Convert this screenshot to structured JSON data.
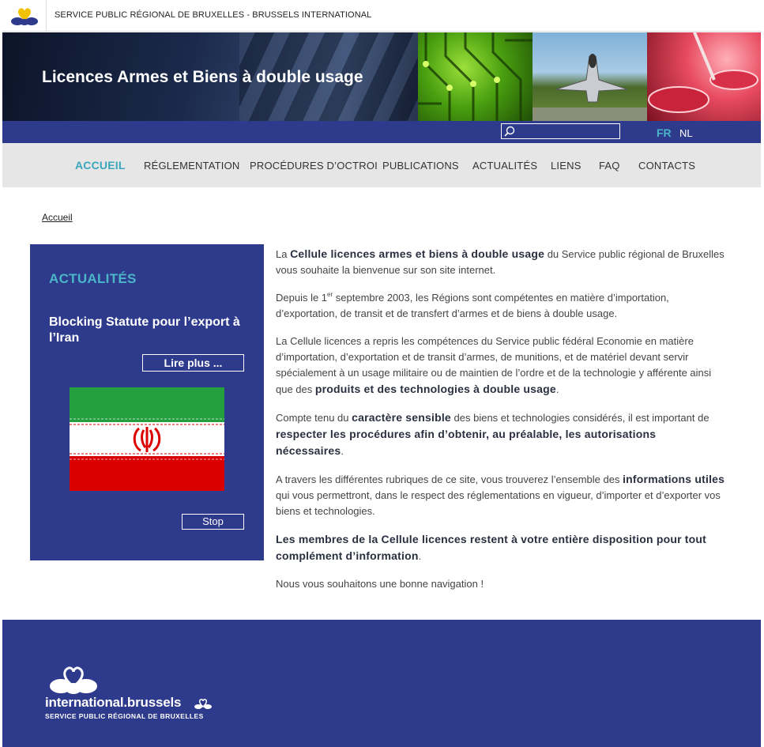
{
  "header": {
    "org_name": "SERVICE PUBLIC RÉGIONAL DE BRUXELLES - BRUSSELS INTERNATIONAL",
    "site_title": "Licences Armes et Biens à double usage"
  },
  "languages": [
    {
      "label": "FR",
      "active": true
    },
    {
      "label": "NL",
      "active": false
    }
  ],
  "search": {
    "placeholder": ""
  },
  "nav": {
    "items": [
      {
        "label": "ACCUEIL",
        "active": true
      },
      {
        "label": "RÉGLEMENTATION"
      },
      {
        "label": "PROCÉDURES D’OCTROI"
      },
      {
        "label": "PUBLICATIONS"
      },
      {
        "label": "ACTUALITÉS"
      },
      {
        "label": "LIENS"
      },
      {
        "label": "FAQ"
      },
      {
        "label": "CONTACTS"
      }
    ]
  },
  "breadcrumb": {
    "home": "Accueil"
  },
  "news": {
    "heading": "ACTUALITÉS",
    "headline": "Blocking Statute pour l’export à l’Iran",
    "read_more": "Lire plus ...",
    "stop": "Stop"
  },
  "main": {
    "p1_a": "La ",
    "p1_b": "Cellule licences armes et biens à double usage",
    "p1_c": " du Service public régional de Bruxelles vous souhaite la bienvenue sur son site internet.",
    "p2_a": "Depuis le 1",
    "p2_sup": "er",
    "p2_b": " septembre 2003, les Régions sont compétentes en matière d’importation, d’exportation, de transit et de transfert d’armes et de biens à double usage.",
    "p3_a": "La Cellule licences a repris les compétences du Service public fédéral Economie en matière d’importation, d’exportation et de transit d’armes, de munitions, et de matériel devant servir spécialement à un usage militaire ou de maintien de l’ordre et de la technologie y afférente ainsi que des ",
    "p3_b": "produits et des technologies à double usage",
    "p3_c": ".",
    "p4_a": "Compte tenu du ",
    "p4_b": "caractère sensible",
    "p4_c": " des biens et technologies considérés, il est important de ",
    "p4_d": "respecter les procédures afin d’obtenir, au préalable, les autorisations nécessaires",
    "p4_e": ".",
    "p5_a": "A travers les différentes rubriques de ce site, vous trouverez l’ensemble des ",
    "p5_b": "informations utiles",
    "p5_c": " qui vous permettront, dans le respect des réglementations en vigueur, d’importer et d’exporter vos biens et technologies.",
    "p6": "Les membres de la Cellule licences restent à votre entière disposition pour tout complément d’information",
    "p6_end": ".",
    "p7": "Nous vous souhaitons une bonne navigation !"
  },
  "footer": {
    "brand": "international.brussels",
    "sub": "SERVICE PUBLIC RÉGIONAL DE BRUXELLES"
  },
  "colors": {
    "primary_blue": "#2e3a8c",
    "accent_teal": "#4bb6c8",
    "nav_bg": "#e6e6e6"
  }
}
